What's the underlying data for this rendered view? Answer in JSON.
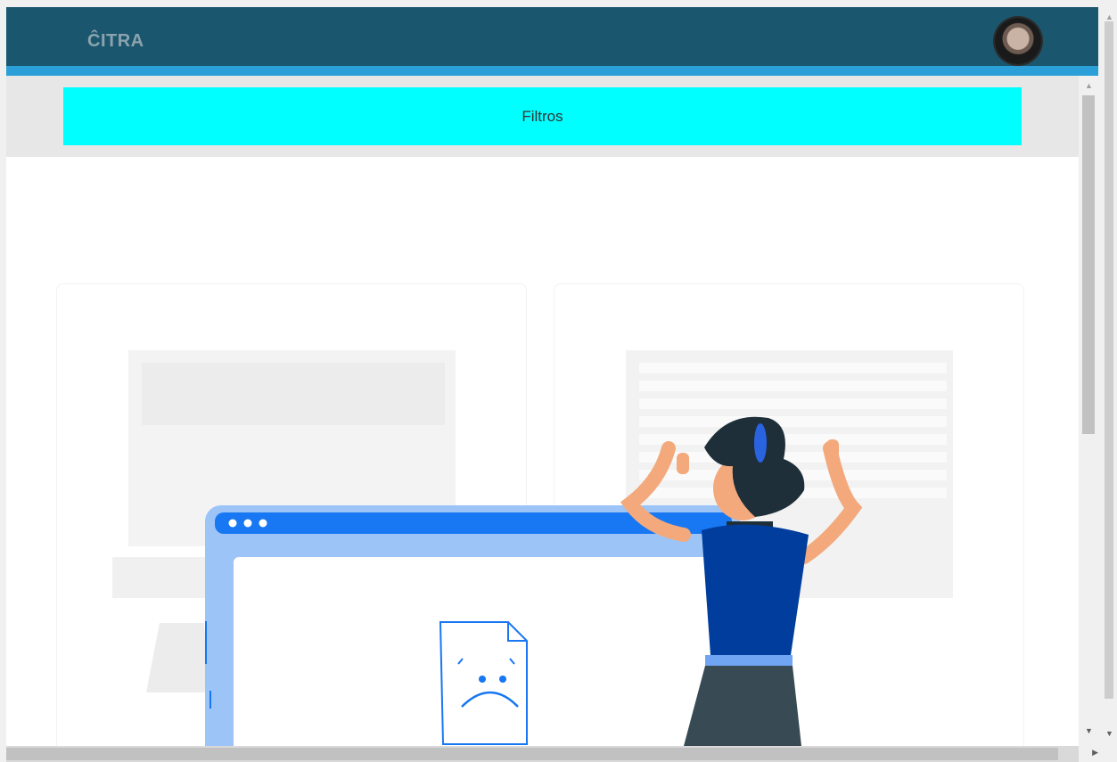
{
  "header": {
    "logo": "ĈITRA"
  },
  "filters": {
    "label": "Filtros"
  },
  "colors": {
    "header_bg": "#1b566f",
    "header_accent": "#2ba0d8",
    "filter_bar": "#00ffff"
  },
  "icons": {
    "avatar": "user-avatar",
    "empty_state": "sad-document-illustration"
  }
}
